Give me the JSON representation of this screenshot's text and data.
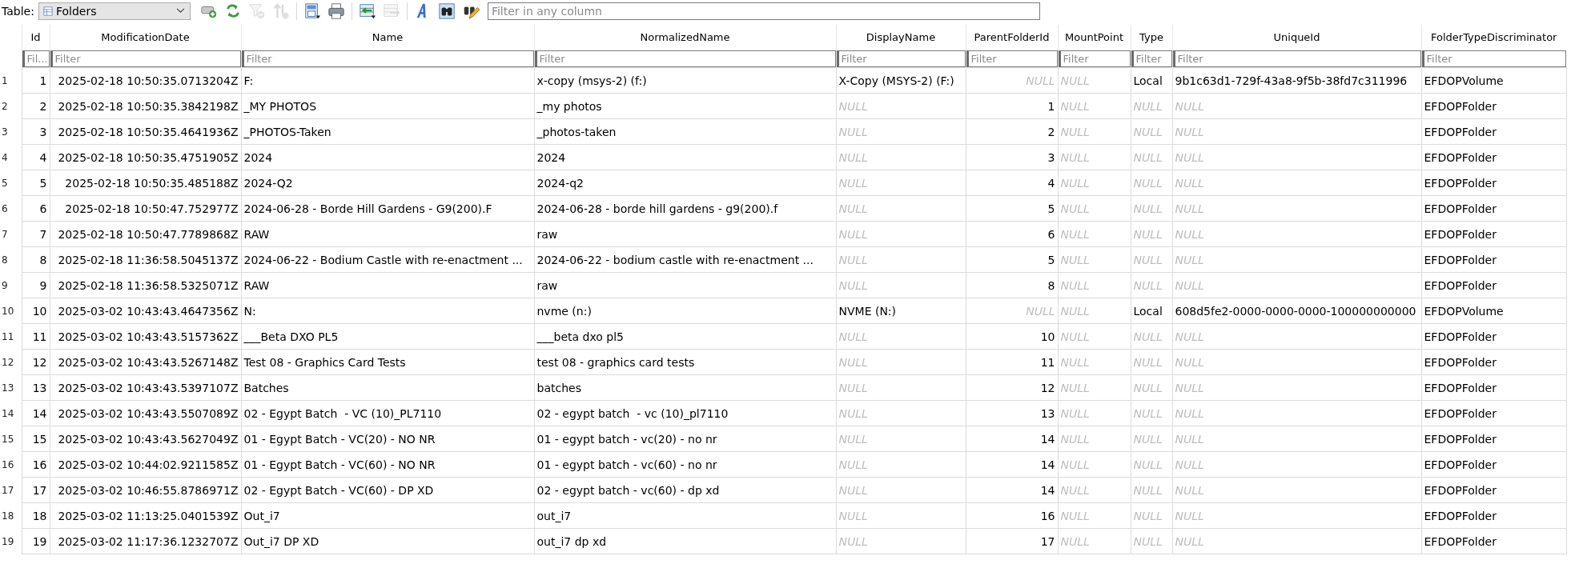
{
  "toolbar": {
    "table_label": "Table:",
    "table_select": {
      "value": "Folders"
    },
    "tools": [
      {
        "kind": "add-record",
        "disabled": false
      },
      {
        "kind": "refresh",
        "disabled": false
      },
      {
        "kind": "clear-filter",
        "disabled": true
      },
      {
        "kind": "sort",
        "disabled": true
      },
      {
        "kind": "save",
        "disabled": false
      },
      {
        "kind": "print",
        "disabled": false
      },
      {
        "kind": "import",
        "disabled": false
      },
      {
        "kind": "export",
        "disabled": true
      },
      {
        "kind": "font",
        "disabled": false
      },
      {
        "kind": "find",
        "disabled": false
      },
      {
        "kind": "edit",
        "disabled": false
      }
    ],
    "filter": {
      "placeholder": "Filter in any column"
    }
  },
  "table": {
    "columns": [
      {
        "label": "Id",
        "filter_placeholder": "Fil...",
        "right_aligned": true
      },
      {
        "label": "ModificationDate",
        "filter_placeholder": "Filter",
        "right_aligned": true
      },
      {
        "label": "Name",
        "filter_placeholder": "Filter",
        "right_aligned": false
      },
      {
        "label": "NormalizedName",
        "filter_placeholder": "Filter",
        "right_aligned": false
      },
      {
        "label": "DisplayName",
        "filter_placeholder": "Filter",
        "right_aligned": false
      },
      {
        "label": "ParentFolderId",
        "filter_placeholder": "Filter",
        "right_aligned": true
      },
      {
        "label": "MountPoint",
        "filter_placeholder": "Filter",
        "right_aligned": false
      },
      {
        "label": "Type",
        "filter_placeholder": "Filter",
        "right_aligned": false
      },
      {
        "label": "UniqueId",
        "filter_placeholder": "Filter",
        "right_aligned": false
      },
      {
        "label": "FolderTypeDiscriminator",
        "filter_placeholder": "Filter",
        "right_aligned": false
      }
    ],
    "rows": [
      {
        "number": "1",
        "cells": [
          "1",
          "2025-02-18 10:50:35.0713204Z",
          "F:",
          "x-copy (msys-2) (f:)",
          "X-Copy (MSYS-2) (F:)",
          {
            "kind": "null",
            "text": "NULL"
          },
          {
            "kind": "null",
            "text": "NULL"
          },
          "Local",
          "9b1c63d1-729f-43a8-9f5b-38fd7c311996",
          "EFDOPVolume"
        ]
      },
      {
        "number": "2",
        "cells": [
          "2",
          "2025-02-18 10:50:35.3842198Z",
          "_MY PHOTOS",
          "_my photos",
          {
            "kind": "null",
            "text": "NULL"
          },
          "1",
          {
            "kind": "null",
            "text": "NULL"
          },
          {
            "kind": "null",
            "text": "NULL"
          },
          {
            "kind": "null",
            "text": "NULL"
          },
          "EFDOPFolder"
        ]
      },
      {
        "number": "3",
        "cells": [
          "3",
          "2025-02-18 10:50:35.4641936Z",
          "_PHOTOS-Taken",
          "_photos-taken",
          {
            "kind": "null",
            "text": "NULL"
          },
          "2",
          {
            "kind": "null",
            "text": "NULL"
          },
          {
            "kind": "null",
            "text": "NULL"
          },
          {
            "kind": "null",
            "text": "NULL"
          },
          "EFDOPFolder"
        ]
      },
      {
        "number": "4",
        "cells": [
          "4",
          "2025-02-18 10:50:35.4751905Z",
          "2024",
          "2024",
          {
            "kind": "null",
            "text": "NULL"
          },
          "3",
          {
            "kind": "null",
            "text": "NULL"
          },
          {
            "kind": "null",
            "text": "NULL"
          },
          {
            "kind": "null",
            "text": "NULL"
          },
          "EFDOPFolder"
        ]
      },
      {
        "number": "5",
        "cells": [
          "5",
          "2025-02-18 10:50:35.485188Z",
          "2024-Q2",
          "2024-q2",
          {
            "kind": "null",
            "text": "NULL"
          },
          "4",
          {
            "kind": "null",
            "text": "NULL"
          },
          {
            "kind": "null",
            "text": "NULL"
          },
          {
            "kind": "null",
            "text": "NULL"
          },
          "EFDOPFolder"
        ]
      },
      {
        "number": "6",
        "cells": [
          "6",
          "2025-02-18 10:50:47.752977Z",
          "2024-06-28 - Borde Hill Gardens - G9(200).F",
          "2024-06-28 - borde hill gardens - g9(200).f",
          {
            "kind": "null",
            "text": "NULL"
          },
          "5",
          {
            "kind": "null",
            "text": "NULL"
          },
          {
            "kind": "null",
            "text": "NULL"
          },
          {
            "kind": "null",
            "text": "NULL"
          },
          "EFDOPFolder"
        ]
      },
      {
        "number": "7",
        "cells": [
          "7",
          "2025-02-18 10:50:47.7789868Z",
          "RAW",
          "raw",
          {
            "kind": "null",
            "text": "NULL"
          },
          "6",
          {
            "kind": "null",
            "text": "NULL"
          },
          {
            "kind": "null",
            "text": "NULL"
          },
          {
            "kind": "null",
            "text": "NULL"
          },
          "EFDOPFolder"
        ]
      },
      {
        "number": "8",
        "cells": [
          "8",
          "2025-02-18 11:36:58.5045137Z",
          "2024-06-22 - Bodium Castle with re-enactment ...",
          "2024-06-22 - bodium castle with re-enactment ...",
          {
            "kind": "null",
            "text": "NULL"
          },
          "5",
          {
            "kind": "null",
            "text": "NULL"
          },
          {
            "kind": "null",
            "text": "NULL"
          },
          {
            "kind": "null",
            "text": "NULL"
          },
          "EFDOPFolder"
        ]
      },
      {
        "number": "9",
        "cells": [
          "9",
          "2025-02-18 11:36:58.5325071Z",
          "RAW",
          "raw",
          {
            "kind": "null",
            "text": "NULL"
          },
          "8",
          {
            "kind": "null",
            "text": "NULL"
          },
          {
            "kind": "null",
            "text": "NULL"
          },
          {
            "kind": "null",
            "text": "NULL"
          },
          "EFDOPFolder"
        ]
      },
      {
        "number": "10",
        "cells": [
          "10",
          "2025-03-02 10:43:43.4647356Z",
          "N:",
          "nvme (n:)",
          "NVME (N:)",
          {
            "kind": "null",
            "text": "NULL"
          },
          {
            "kind": "null",
            "text": "NULL"
          },
          "Local",
          "608d5fe2-0000-0000-0000-100000000000",
          "EFDOPVolume"
        ]
      },
      {
        "number": "11",
        "cells": [
          "11",
          "2025-03-02 10:43:43.5157362Z",
          "___Beta DXO PL5",
          "___beta dxo pl5",
          {
            "kind": "null",
            "text": "NULL"
          },
          "10",
          {
            "kind": "null",
            "text": "NULL"
          },
          {
            "kind": "null",
            "text": "NULL"
          },
          {
            "kind": "null",
            "text": "NULL"
          },
          "EFDOPFolder"
        ]
      },
      {
        "number": "12",
        "cells": [
          "12",
          "2025-03-02 10:43:43.5267148Z",
          "Test 08 - Graphics Card Tests",
          "test 08 - graphics card tests",
          {
            "kind": "null",
            "text": "NULL"
          },
          "11",
          {
            "kind": "null",
            "text": "NULL"
          },
          {
            "kind": "null",
            "text": "NULL"
          },
          {
            "kind": "null",
            "text": "NULL"
          },
          "EFDOPFolder"
        ]
      },
      {
        "number": "13",
        "cells": [
          "13",
          "2025-03-02 10:43:43.5397107Z",
          "Batches",
          "batches",
          {
            "kind": "null",
            "text": "NULL"
          },
          "12",
          {
            "kind": "null",
            "text": "NULL"
          },
          {
            "kind": "null",
            "text": "NULL"
          },
          {
            "kind": "null",
            "text": "NULL"
          },
          "EFDOPFolder"
        ]
      },
      {
        "number": "14",
        "cells": [
          "14",
          "2025-03-02 10:43:43.5507089Z",
          "02 - Egypt Batch  - VC (10)_PL7110",
          "02 - egypt batch  - vc (10)_pl7110",
          {
            "kind": "null",
            "text": "NULL"
          },
          "13",
          {
            "kind": "null",
            "text": "NULL"
          },
          {
            "kind": "null",
            "text": "NULL"
          },
          {
            "kind": "null",
            "text": "NULL"
          },
          "EFDOPFolder"
        ]
      },
      {
        "number": "15",
        "cells": [
          "15",
          "2025-03-02 10:43:43.5627049Z",
          "01 - Egypt Batch - VC(20) - NO NR",
          "01 - egypt batch - vc(20) - no nr",
          {
            "kind": "null",
            "text": "NULL"
          },
          "14",
          {
            "kind": "null",
            "text": "NULL"
          },
          {
            "kind": "null",
            "text": "NULL"
          },
          {
            "kind": "null",
            "text": "NULL"
          },
          "EFDOPFolder"
        ]
      },
      {
        "number": "16",
        "cells": [
          "16",
          "2025-03-02 10:44:02.9211585Z",
          "01 - Egypt Batch - VC(60) - NO NR",
          "01 - egypt batch - vc(60) - no nr",
          {
            "kind": "null",
            "text": "NULL"
          },
          "14",
          {
            "kind": "null",
            "text": "NULL"
          },
          {
            "kind": "null",
            "text": "NULL"
          },
          {
            "kind": "null",
            "text": "NULL"
          },
          "EFDOPFolder"
        ]
      },
      {
        "number": "17",
        "cells": [
          "17",
          "2025-03-02 10:46:55.8786971Z",
          "02 - Egypt Batch - VC(60) - DP XD",
          "02 - egypt batch - vc(60) - dp xd",
          {
            "kind": "null",
            "text": "NULL"
          },
          "14",
          {
            "kind": "null",
            "text": "NULL"
          },
          {
            "kind": "null",
            "text": "NULL"
          },
          {
            "kind": "null",
            "text": "NULL"
          },
          "EFDOPFolder"
        ]
      },
      {
        "number": "18",
        "cells": [
          "18",
          "2025-03-02 11:13:25.0401539Z",
          "Out_i7",
          "out_i7",
          {
            "kind": "null",
            "text": "NULL"
          },
          "16",
          {
            "kind": "null",
            "text": "NULL"
          },
          {
            "kind": "null",
            "text": "NULL"
          },
          {
            "kind": "null",
            "text": "NULL"
          },
          "EFDOPFolder"
        ]
      },
      {
        "number": "19",
        "cells": [
          "19",
          "2025-03-02 11:17:36.1232707Z",
          "Out_i7 DP XD",
          "out_i7 dp xd",
          {
            "kind": "null",
            "text": "NULL"
          },
          "17",
          {
            "kind": "null",
            "text": "NULL"
          },
          {
            "kind": "null",
            "text": "NULL"
          },
          {
            "kind": "null",
            "text": "NULL"
          },
          "EFDOPFolder"
        ]
      }
    ]
  }
}
